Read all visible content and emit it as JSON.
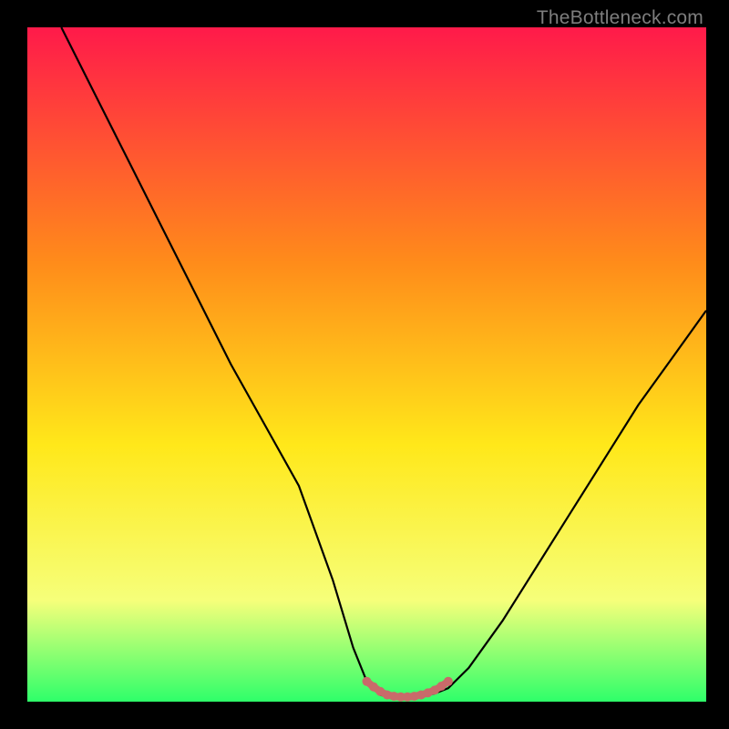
{
  "watermark": "TheBottleneck.com",
  "colors": {
    "gradient_top": "#ff1a4a",
    "gradient_mid1": "#ff8c1a",
    "gradient_mid2": "#ffe81a",
    "gradient_mid3": "#f6ff7a",
    "gradient_bottom": "#2eff6a",
    "curve": "#000000",
    "marker": "#c96a6a"
  },
  "chart_data": {
    "type": "line",
    "title": "",
    "xlabel": "",
    "ylabel": "",
    "xlim": [
      0,
      100
    ],
    "ylim": [
      0,
      100
    ],
    "series": [
      {
        "name": "bottleneck-curve",
        "x": [
          5,
          10,
          15,
          20,
          25,
          30,
          35,
          40,
          45,
          48,
          50,
          52,
          54,
          56,
          58,
          60,
          62,
          65,
          70,
          75,
          80,
          85,
          90,
          95,
          100
        ],
        "y": [
          100,
          90,
          80,
          70,
          60,
          50,
          41,
          32,
          18,
          8,
          3,
          1,
          0.5,
          0.5,
          0.8,
          1.2,
          2,
          5,
          12,
          20,
          28,
          36,
          44,
          51,
          58
        ]
      }
    ],
    "markers": {
      "name": "sweet-spot",
      "x": [
        50,
        51,
        52,
        53,
        54,
        55,
        56,
        57,
        58,
        59,
        60,
        61,
        62
      ],
      "y": [
        3,
        2.2,
        1.5,
        1,
        0.8,
        0.7,
        0.7,
        0.8,
        1,
        1.3,
        1.7,
        2.3,
        3
      ]
    }
  }
}
